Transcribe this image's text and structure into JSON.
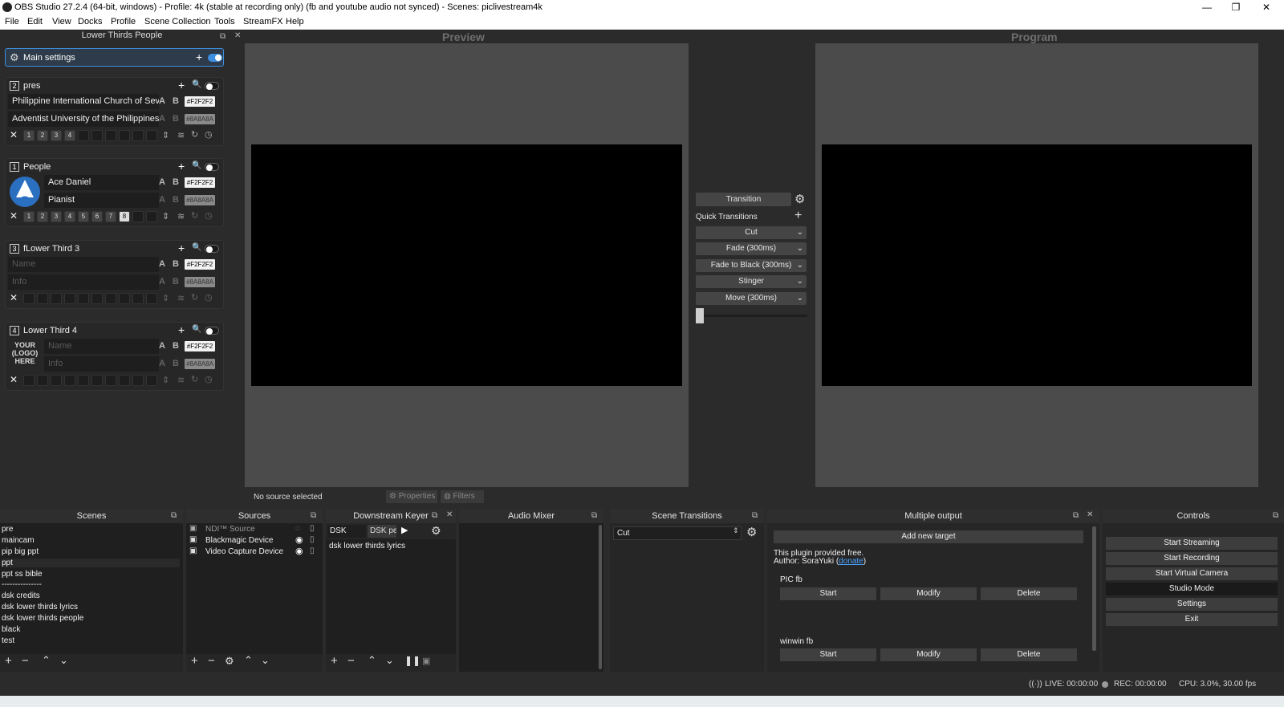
{
  "window": {
    "title": "OBS Studio 27.2.4 (64-bit, windows) - Profile: 4k (stable at recording only) (fb and youtube audio not synced) - Scenes: piclivestream4k",
    "minimize": "—",
    "maximize": "❐",
    "close": "✕"
  },
  "menu": [
    "File",
    "Edit",
    "View",
    "Docks",
    "Profile",
    "Scene Collection",
    "Tools",
    "StreamFX",
    "Help"
  ],
  "lower_thirds": {
    "dock_title": "Lower Thirds People",
    "main_settings": "Main settings",
    "blocks": [
      {
        "num": "2",
        "name": "pres",
        "field1": "Philippine International Church of Seventh",
        "field2": "Adventist University of the Philippines",
        "color1": "#F2F2F2",
        "color2": "#8A8A8A",
        "slots": [
          "1",
          "2",
          "3",
          "4"
        ]
      },
      {
        "num": "1",
        "name": "People",
        "field1": "Ace Daniel",
        "field2": "Pianist",
        "color1": "#F2F2F2",
        "color2": "#8A8A8A",
        "slots": [
          "1",
          "2",
          "3",
          "4",
          "5",
          "6",
          "7",
          "8"
        ]
      },
      {
        "num": "3",
        "name": "fLower Third 3",
        "field1": "Name",
        "field2": "Info",
        "color1": "#F2F2F2",
        "color2": "#8A8A8A"
      },
      {
        "num": "4",
        "name": "Lower Third 4",
        "field1": "Name",
        "field2": "Info",
        "color1": "#F2F2F2",
        "color2": "#8A8A8A",
        "logo_text": "YOUR\n(LOGO)\nHERE"
      }
    ]
  },
  "preview": {
    "title": "Preview"
  },
  "program": {
    "title": "Program"
  },
  "transitions_panel": {
    "transition": "Transition",
    "quick_transitions": "Quick Transitions",
    "items": [
      "Cut",
      "Fade (300ms)",
      "Fade to Black (300ms)",
      "Stinger",
      "Move (300ms)"
    ]
  },
  "source_bar": {
    "status": "No source selected",
    "properties": "Properties",
    "filters": "Filters"
  },
  "scenes": {
    "title": "Scenes",
    "items": [
      "pre",
      "maincam",
      "pip big ppt",
      "ppt",
      "ppt ss bible",
      "---------------",
      "dsk credits",
      "dsk lower thirds lyrics",
      "dsk lower thirds people",
      "black",
      "test"
    ],
    "selected": "ppt"
  },
  "sources": {
    "title": "Sources",
    "items": [
      "NDI™ Source",
      "Blackmagic Device",
      "Video Capture Device"
    ]
  },
  "dsk": {
    "title": "Downstream Keyer",
    "tabs": [
      "DSK lyrics",
      "DSK pe"
    ],
    "items": [
      "dsk lower thirds lyrics"
    ]
  },
  "audio_mixer": {
    "title": "Audio Mixer"
  },
  "scene_transitions": {
    "title": "Scene Transitions",
    "value": "Cut"
  },
  "multiple_output": {
    "title": "Multiple output",
    "add_target": "Add new target",
    "note1": "This plugin provided free.",
    "note2_prefix": "Author: SoraYuki (",
    "note2_link": "donate",
    "note2_suffix": ")",
    "targets": [
      {
        "name": "PIC fb",
        "start": "Start",
        "modify": "Modify",
        "delete": "Delete"
      },
      {
        "name": "winwin fb",
        "start": "Start",
        "modify": "Modify",
        "delete": "Delete"
      }
    ]
  },
  "controls": {
    "title": "Controls",
    "buttons": [
      "Start Streaming",
      "Start Recording",
      "Start Virtual Camera",
      "Studio Mode",
      "Settings",
      "Exit"
    ]
  },
  "status": {
    "live": "LIVE: 00:00:00",
    "rec": "REC: 00:00:00",
    "cpu": "CPU: 3.0%, 30.00 fps"
  }
}
